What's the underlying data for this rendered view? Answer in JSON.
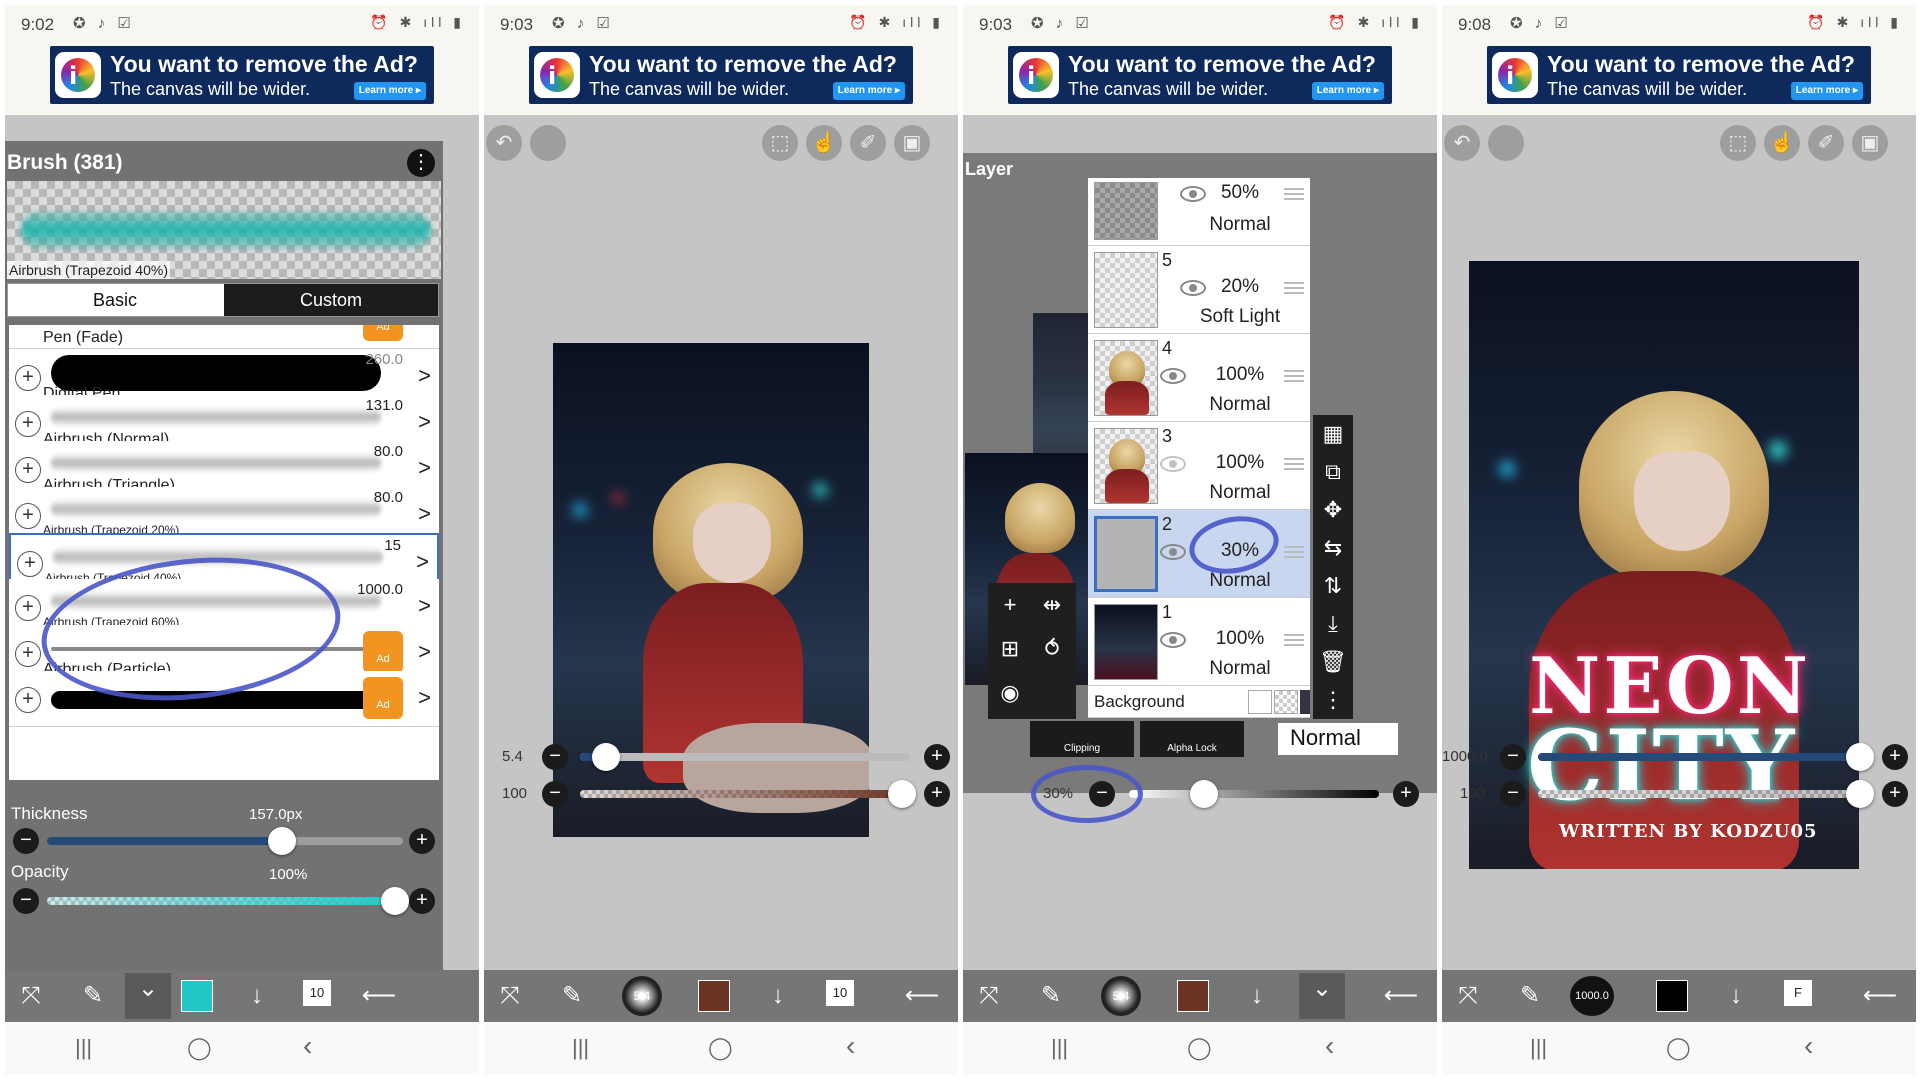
{
  "status": {
    "panels": [
      {
        "time": "9:02"
      },
      {
        "time": "9:03"
      },
      {
        "time": "9:03"
      },
      {
        "time": "9:08"
      }
    ],
    "left_icons": "✪ ♪ ☑",
    "right_icons": "⏰ ✱ ıll ▮"
  },
  "ad": {
    "title": "You want to remove the Ad?",
    "subtitle": "The canvas will be wider.",
    "button": "Learn more ▸",
    "icon": "ibispaint-logo-icon"
  },
  "panel1": {
    "brush_title": "Brush (381)",
    "menu_icon": "⋮",
    "preview_label": "Airbrush (Trapezoid 40%)",
    "tabs": [
      "Basic",
      "Custom"
    ],
    "brushes": [
      {
        "name": "Pen (Fade)",
        "size": "",
        "locked": true
      },
      {
        "name": "Digital Pen",
        "size": "260.0",
        "locked": false
      },
      {
        "name": "Airbrush (Normal)",
        "size": "131.0",
        "locked": false
      },
      {
        "name": "Airbrush (Triangle)",
        "size": "80.0",
        "locked": false
      },
      {
        "name": "Airbrush (Trapezoid 20%)",
        "size": "80.0",
        "locked": false
      },
      {
        "name": "Airbrush (Trapezoid 40%)",
        "size": "15",
        "locked": false,
        "selected": true
      },
      {
        "name": "Airbrush (Trapezoid 60%)",
        "size": "1000.0",
        "locked": false
      },
      {
        "name": "Airbrush (Particle)",
        "size": "",
        "locked": true
      },
      {
        "name": "",
        "size": "",
        "locked": true
      }
    ],
    "lock_label": "Ad",
    "thickness_label": "Thickness",
    "thickness_value": "157.0px",
    "thickness_fraction": 0.66,
    "opacity_label": "Opacity",
    "opacity_value": "100%",
    "opacity_fraction": 1.0,
    "color": "#1fc7c7",
    "layer_count": "10"
  },
  "panel2": {
    "size_value": "5.4",
    "size_fraction": 0.08,
    "opacity_value": "100",
    "opacity_fraction": 1.0,
    "brush_size_badge": "5.4",
    "color": "#6b3424",
    "layer_count": "10"
  },
  "panel3": {
    "layer_title": "Layer",
    "layers": [
      {
        "num": "",
        "opacity": "50%",
        "mode": "Normal"
      },
      {
        "num": "5",
        "opacity": "20%",
        "mode": "Soft Light"
      },
      {
        "num": "4",
        "opacity": "100%",
        "mode": "Normal"
      },
      {
        "num": "3",
        "opacity": "100%",
        "mode": "Normal"
      },
      {
        "num": "2",
        "opacity": "30%",
        "mode": "Normal",
        "selected": true
      },
      {
        "num": "1",
        "opacity": "100%",
        "mode": "Normal"
      }
    ],
    "background_label": "Background",
    "clipping_label": "Clipping",
    "alpha_lock_label": "Alpha Lock",
    "blend_mode": "Normal",
    "opacity_value": "30%",
    "opacity_fraction": 0.3,
    "brush_size_badge": "5.4",
    "color": "#6b3424"
  },
  "panel4": {
    "size_value": "1000.0",
    "size_fraction": 1.0,
    "opacity_value": "100",
    "opacity_fraction": 1.0,
    "brush_size_badge": "1000.0",
    "color": "#000000",
    "layer_badge": "F",
    "title_line1": "NEON",
    "title_line2": "CITY",
    "byline": "WRITTEN BY KODZU05"
  },
  "nav": {
    "recent": "|||",
    "home": "◯",
    "back": "‹"
  },
  "colors": {
    "annotation": "#4a56c8",
    "selection": "#3a6fc4",
    "slider_fill": "#234a78"
  }
}
